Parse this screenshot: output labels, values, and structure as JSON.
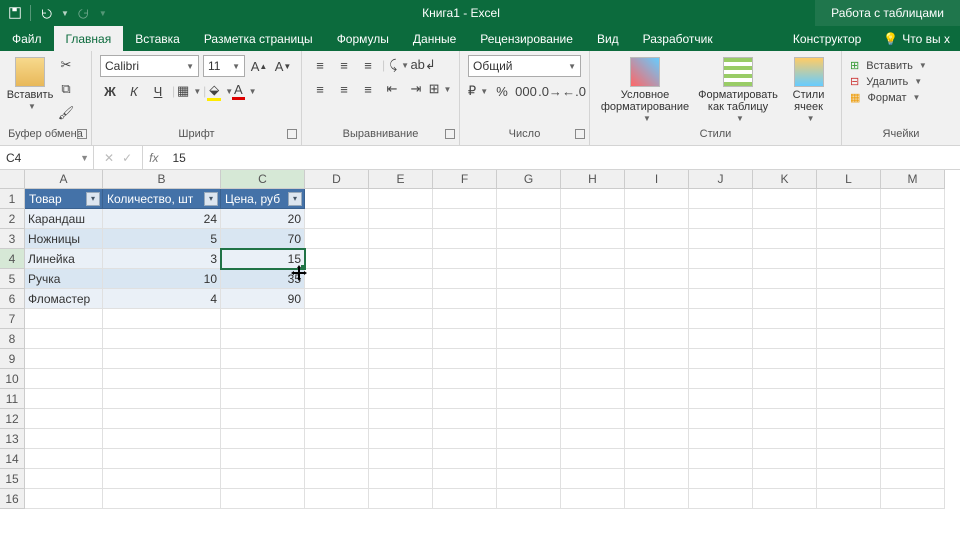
{
  "titlebar": {
    "title": "Книга1 - Excel",
    "context_label": "Работа с таблицами"
  },
  "tabs": {
    "items": [
      "Файл",
      "Главная",
      "Вставка",
      "Разметка страницы",
      "Формулы",
      "Данные",
      "Рецензирование",
      "Вид",
      "Разработчик"
    ],
    "active_index": 1,
    "context_tab": "Конструктор",
    "tell_me": "Что вы х"
  },
  "ribbon": {
    "clipboard": {
      "paste": "Вставить",
      "label": "Буфер обмена"
    },
    "font": {
      "name": "Calibri",
      "size": "11",
      "bold": "Ж",
      "italic": "К",
      "underline": "Ч",
      "label": "Шрифт"
    },
    "alignment": {
      "wrap": "",
      "merge": "",
      "label": "Выравнивание"
    },
    "number": {
      "format": "Общий",
      "label": "Число"
    },
    "styles": {
      "conditional": "Условное форматирование",
      "as_table": "Форматировать как таблицу",
      "cell_styles": "Стили ячеек",
      "label": "Стили"
    },
    "cells": {
      "insert": "Вставить",
      "delete": "Удалить",
      "format": "Формат",
      "label": "Ячейки"
    }
  },
  "formula_bar": {
    "name_box": "C4",
    "fx": "fx",
    "value": "15"
  },
  "grid": {
    "columns": [
      {
        "letter": "A",
        "width": 78
      },
      {
        "letter": "B",
        "width": 118
      },
      {
        "letter": "C",
        "width": 84
      },
      {
        "letter": "D",
        "width": 64
      },
      {
        "letter": "E",
        "width": 64
      },
      {
        "letter": "F",
        "width": 64
      },
      {
        "letter": "G",
        "width": 64
      },
      {
        "letter": "H",
        "width": 64
      },
      {
        "letter": "I",
        "width": 64
      },
      {
        "letter": "J",
        "width": 64
      },
      {
        "letter": "K",
        "width": 64
      },
      {
        "letter": "L",
        "width": 64
      },
      {
        "letter": "M",
        "width": 64
      }
    ],
    "headers": [
      "Товар",
      "Количество, шт",
      "Цена, руб"
    ],
    "rows": [
      {
        "n": 1
      },
      {
        "n": 2,
        "cells": [
          "Карандаш",
          "24",
          "20"
        ]
      },
      {
        "n": 3,
        "cells": [
          "Ножницы",
          "5",
          "70"
        ]
      },
      {
        "n": 4,
        "cells": [
          "Линейка",
          "3",
          "15"
        ]
      },
      {
        "n": 5,
        "cells": [
          "Ручка",
          "10",
          "35"
        ]
      },
      {
        "n": 6,
        "cells": [
          "Фломастер",
          "4",
          "90"
        ]
      },
      {
        "n": 7
      },
      {
        "n": 8
      },
      {
        "n": 9
      },
      {
        "n": 10
      },
      {
        "n": 11
      },
      {
        "n": 12
      },
      {
        "n": 13
      },
      {
        "n": 14
      },
      {
        "n": 15
      },
      {
        "n": 16
      }
    ],
    "active": {
      "row": 4,
      "col": "C"
    }
  }
}
